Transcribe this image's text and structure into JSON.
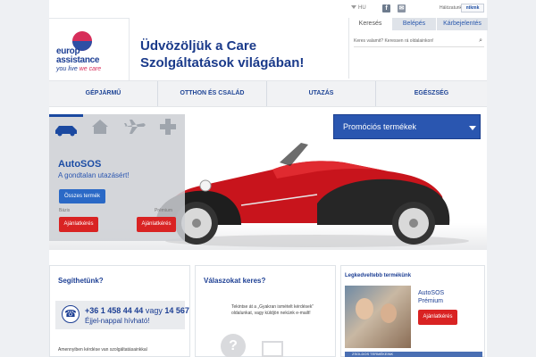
{
  "topbar": {
    "language": "HU",
    "social": [
      "facebook-icon",
      "mail-icon"
    ],
    "network_label": "Hálózatunk",
    "ntv_label": "ntkmk"
  },
  "brand": {
    "line1": "europ",
    "line2": "assistance",
    "tagline_a": "you live",
    "tagline_b": "we care",
    "colors": {
      "blue": "#1d3f94",
      "pink": "#d72e5a"
    }
  },
  "welcome": {
    "line1": "Üdvözöljük a Care",
    "line2": "Szolgáltatások világában!"
  },
  "search_panel": {
    "tabs": [
      "Keresés",
      "Belépés",
      "Kárbejelentés"
    ],
    "active_tab": "Keresés",
    "placeholder": "Keres valamit? Keressen rá oldalainkon!"
  },
  "nav": {
    "items": [
      "GÉPJÁRMŰ",
      "OTTHON ÉS CSALÁD",
      "UTAZÁS",
      "EGÉSZSÉG"
    ]
  },
  "hero": {
    "categories": [
      "car-icon",
      "house-icon",
      "plane-icon",
      "cross-icon"
    ],
    "title": "AutoSOS",
    "subtitle": "A gondtalan utazásért!",
    "all_products_button": "Összes termék",
    "tier_basic": "Bázis",
    "tier_premium": "Prémium",
    "quote_button": "Ajánlatkérés",
    "promo_heading": "Promóciós termékek"
  },
  "help_box": {
    "title": "Segíthetünk?",
    "phone1": "+36 1 458 44 44",
    "or_text": "vagy",
    "phone2": "14 567",
    "hours": "Éjjel-nappal hívható!",
    "note": "Amennyiben kérdése van szolgáltatásainkkal"
  },
  "faq_box": {
    "title": "Válaszokat keres?",
    "text": "Tekintse át a „Gyakran ismételt kérdések” oldalunkat, vagy küldjön nekünk e-mailt!"
  },
  "popular_box": {
    "title": "Legkedveltebb termékünk",
    "product_line1": "AutoSOS",
    "product_line2": "Prémium",
    "button": "Ajánlatkérés",
    "footer_text": "ZSOLDOS TERMÉKEINK"
  }
}
